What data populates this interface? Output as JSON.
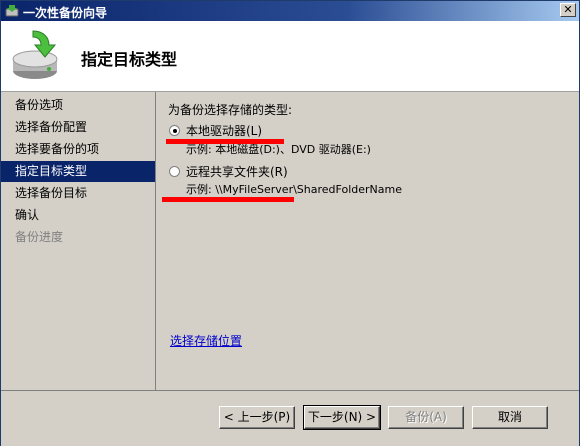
{
  "window": {
    "title": "一次性备份向导",
    "close_glyph": "✕"
  },
  "header": {
    "title": "指定目标类型",
    "icon": "backup-drive-icon"
  },
  "sidebar": {
    "items": [
      {
        "label": "备份选项",
        "state": "normal"
      },
      {
        "label": "选择备份配置",
        "state": "normal"
      },
      {
        "label": "选择要备份的项",
        "state": "normal"
      },
      {
        "label": "指定目标类型",
        "state": "selected"
      },
      {
        "label": "选择备份目标",
        "state": "normal"
      },
      {
        "label": "确认",
        "state": "normal"
      },
      {
        "label": "备份进度",
        "state": "disabled"
      }
    ]
  },
  "content": {
    "prompt": "为备份选择存储的类型:",
    "options": [
      {
        "label": "本地驱动器(L)",
        "example": "示例: 本地磁盘(D:)、DVD 驱动器(E:)",
        "selected": true
      },
      {
        "label": "远程共享文件夹(R)",
        "example": "示例: \\\\MyFileServer\\SharedFolderName",
        "selected": false
      }
    ],
    "link": "选择存储位置"
  },
  "footer": {
    "back": "< 上一步(P)",
    "next": "下一步(N) >",
    "backup": "备份(A)",
    "cancel": "取消"
  },
  "colors": {
    "selection": "#0a246a",
    "redaction": "#ff0000",
    "link": "#0000cc"
  }
}
